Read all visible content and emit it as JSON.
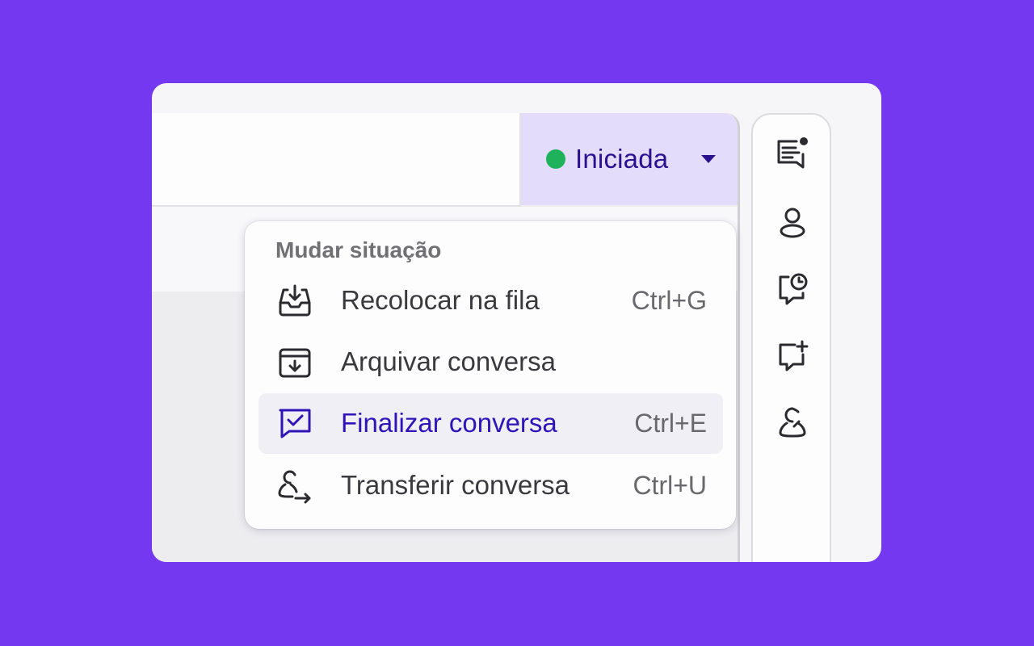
{
  "status": {
    "label": "Iniciada",
    "dot_color": "#1fb25a"
  },
  "rail": {
    "icons": [
      "conversation-notification-icon",
      "contact-person-icon",
      "scheduled-message-icon",
      "new-message-icon",
      "agent-person-icon"
    ]
  },
  "menu": {
    "header": "Mudar situação",
    "items": [
      {
        "label": "Recolocar na fila",
        "shortcut": "Ctrl+G",
        "icon": "inbox-download-icon",
        "active": false
      },
      {
        "label": "Arquivar conversa",
        "shortcut": "",
        "icon": "archive-box-icon",
        "active": false
      },
      {
        "label": "Finalizar conversa",
        "shortcut": "Ctrl+E",
        "icon": "chat-check-icon",
        "active": true
      },
      {
        "label": "Transferir conversa",
        "shortcut": "Ctrl+U",
        "icon": "transfer-person-icon",
        "active": false
      }
    ]
  },
  "colors": {
    "background": "#7338f0",
    "accent": "#3014b8",
    "status_bg": "#e3dcfa"
  }
}
